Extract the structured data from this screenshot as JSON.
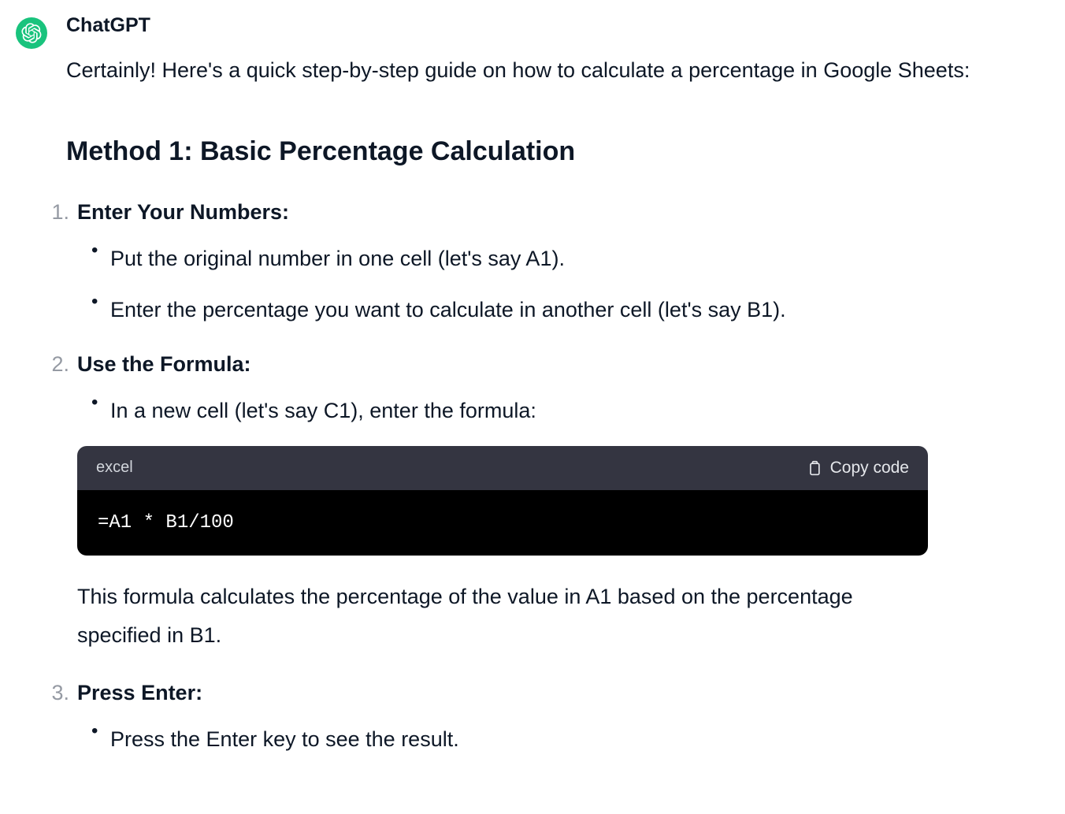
{
  "author": "ChatGPT",
  "intro": "Certainly! Here's a quick step-by-step guide on how to calculate a percentage in Google Sheets:",
  "method_heading": "Method 1: Basic Percentage Calculation",
  "steps": [
    {
      "title": "Enter Your Numbers:",
      "bullets": [
        "Put the original number in one cell (let's say A1).",
        "Enter the percentage you want to calculate in another cell (let's say B1)."
      ]
    },
    {
      "title": "Use the Formula:",
      "bullets": [
        "In a new cell (let's say C1), enter the formula:"
      ],
      "code": {
        "lang": "excel",
        "copy_label": "Copy code",
        "content": "=A1 * B1/100",
        "explain": "This formula calculates the percentage of the value in A1 based on the percentage specified in B1."
      }
    },
    {
      "title": "Press Enter:",
      "bullets": [
        "Press the Enter key to see the result."
      ]
    }
  ]
}
